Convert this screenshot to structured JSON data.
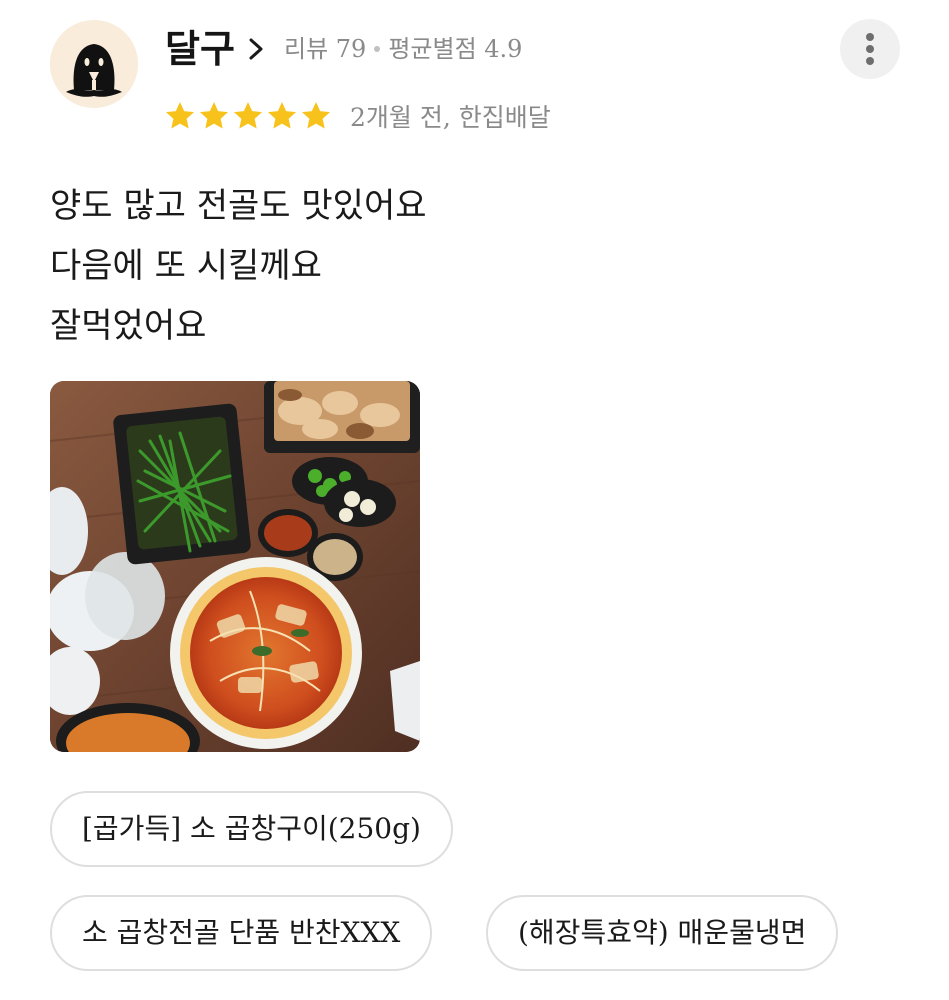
{
  "reviewer": {
    "name": "달구",
    "review_count_text": "리뷰 79",
    "avg_rating_text": "평균별점 4.9",
    "avatar_icon": "ghost-avatar-icon"
  },
  "review": {
    "rating": 5,
    "rating_max": 5,
    "meta_text": "2개월 전, 한집배달",
    "lines": [
      "양도 많고 전골도 맛있어요",
      "다음에 또 시킬께요",
      "잘먹었어요"
    ],
    "photo_icon": "food-photo"
  },
  "menu_tags": [
    "[곱가득] 소 곱창구이(250g)",
    "소 곱창전골 단품 반찬XXX",
    "(해장특효약) 매운물냉면"
  ],
  "colors": {
    "star": "#f8c21c",
    "meta_gray": "#8a8a8a",
    "chip_border": "#dedede"
  }
}
